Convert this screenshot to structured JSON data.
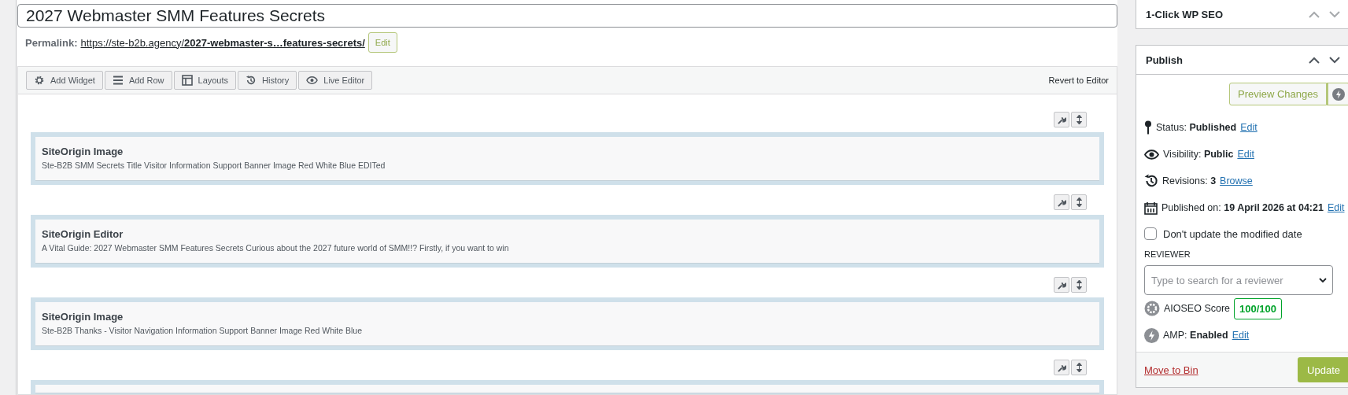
{
  "post": {
    "title": "2027 Webmaster SMM Features Secrets",
    "permalink_label": "Permalink:",
    "permalink_base": "https://ste-b2b.agency/",
    "permalink_slug": "2027-webmaster-s…features-secrets/",
    "permalink_edit": "Edit"
  },
  "builder": {
    "toolbar": [
      {
        "kind": "widget",
        "label": "Add Widget"
      },
      {
        "kind": "row",
        "label": "Add Row"
      },
      {
        "kind": "layouts",
        "label": "Layouts"
      },
      {
        "kind": "history",
        "label": "History"
      },
      {
        "kind": "live",
        "label": "Live Editor"
      }
    ],
    "revert": "Revert to Editor",
    "widgets": [
      {
        "kind": "full",
        "title": "SiteOrigin Image",
        "description": "Ste-B2B SMM Secrets Title Visitor Information Support Banner Image Red White Blue EDITed"
      },
      {
        "kind": "full",
        "title": "SiteOrigin Editor",
        "description": "A Vital Guide: 2027 Webmaster SMM Features Secrets Curious about the 2027 future world of SMM!!? Firstly, if you want to win"
      },
      {
        "kind": "full",
        "title": "SiteOrigin Image",
        "description": "Ste-B2B Thanks - Visitor Navigation Information Support Banner Image Red White Blue"
      },
      {
        "kind": "partial"
      }
    ]
  },
  "sidebar": {
    "seo_box": {
      "title": "1-Click WP SEO"
    },
    "publish": {
      "title": "Publish",
      "preview": "Preview Changes",
      "meta": [
        {
          "kind": "status",
          "label": "Status:",
          "value": "Published",
          "link": "Edit"
        },
        {
          "kind": "visibility",
          "label": "Visibility:",
          "value": "Public",
          "link": "Edit"
        },
        {
          "kind": "revisions",
          "label": "Revisions:",
          "value": "3",
          "link": "Browse"
        },
        {
          "kind": "published",
          "label": "Published on:",
          "value": "19 April 2026 at 04:21",
          "link": "Edit"
        }
      ],
      "checkbox": {
        "label": "Don't update the modified date",
        "checked": false
      },
      "reviewer_label": "REVIEWER",
      "reviewer_placeholder": "Type to search for a reviewer",
      "score_label": "AIOSEO Score",
      "score": "100/100",
      "amp": {
        "label": "AMP:",
        "value": "Enabled",
        "link": "Edit"
      },
      "trash": "Move to Bin",
      "update": "Update"
    }
  }
}
